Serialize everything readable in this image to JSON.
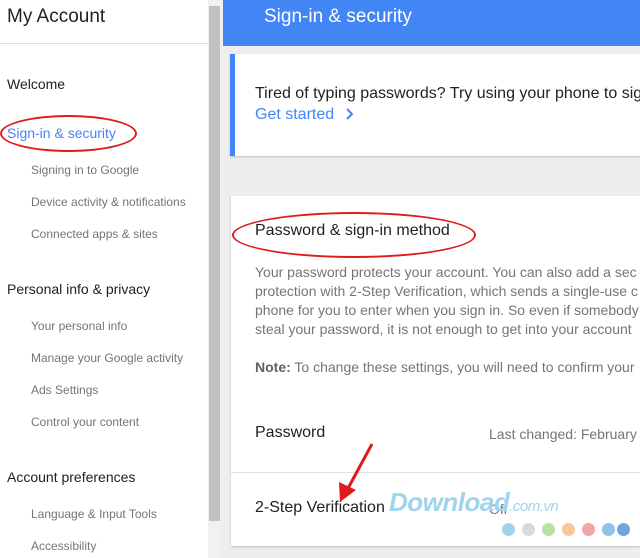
{
  "sidebar": {
    "title": "My Account",
    "sections": [
      {
        "label": "Welcome"
      },
      {
        "label": "Sign-in & security",
        "items": [
          "Signing in to Google",
          "Device activity & notifications",
          "Connected apps & sites"
        ]
      },
      {
        "label": "Personal info & privacy",
        "items": [
          "Your personal info",
          "Manage your Google activity",
          "Ads Settings",
          "Control your content"
        ]
      },
      {
        "label": "Account preferences",
        "items": [
          "Language & Input Tools",
          "Accessibility"
        ]
      }
    ]
  },
  "header": {
    "title": "Sign-in & security"
  },
  "promo": {
    "text": "Tired of typing passwords? Try using your phone to sig",
    "link_label": "Get started",
    "link_icon": "chevron-right-icon"
  },
  "password_card": {
    "title": "Password & sign-in method",
    "description_lines": [
      "Your password protects your account. You can also add a sec",
      "protection with 2-Step Verification, which sends a single-use c",
      "phone for you to enter when you sign in. So even if somebody",
      "steal your password, it is not enough to get into your account"
    ],
    "note_label": "Note:",
    "note_text": " To change these settings, you will need to confirm your",
    "rows": [
      {
        "label": "Password",
        "value": "Last changed: February"
      },
      {
        "label": "2-Step Verification",
        "value": "Off"
      }
    ]
  },
  "watermark": {
    "text": "Download",
    "ext": ".com.vn",
    "dot_colors": [
      "#9fd3ee",
      "#d9d9d9",
      "#b9e2a0",
      "#f7c99a",
      "#f3a6a6",
      "#8fc3ea",
      "#6fa6dd"
    ]
  },
  "colors": {
    "accent": "#4285f4",
    "annotation": "#e01b1b"
  }
}
